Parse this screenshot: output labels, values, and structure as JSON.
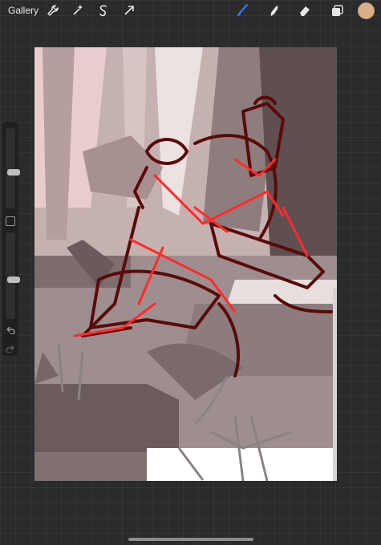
{
  "topbar": {
    "gallery_label": "Gallery",
    "left_tools": [
      "wrench-icon",
      "magic-wand-icon",
      "selection-icon",
      "transform-arrow-icon"
    ],
    "right_tools": [
      "brush-icon",
      "smudge-icon",
      "eraser-icon",
      "layers-icon"
    ],
    "active_tool": "brush-icon",
    "active_color": "#d8b08a"
  },
  "sidebar": {
    "brush_size": 0.45,
    "opacity": 0.45
  },
  "colors": {
    "accent": "#2f7bf5",
    "sketch_red": "#ff2a2a",
    "sketch_dark_red": "#5b0a0a"
  }
}
